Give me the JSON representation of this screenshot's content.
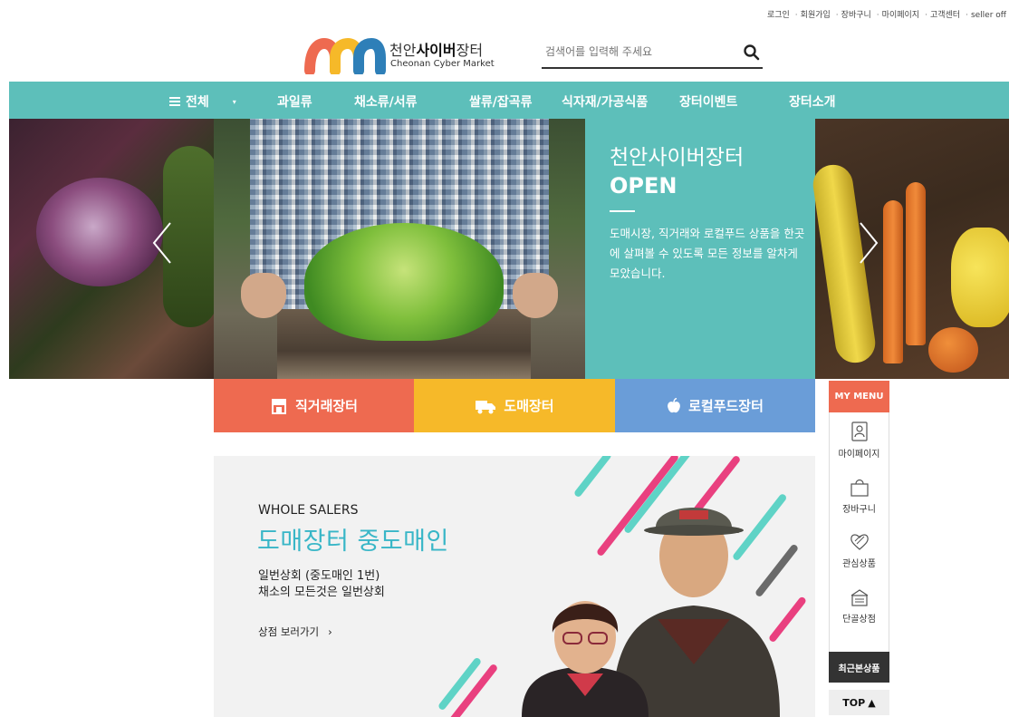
{
  "util": {
    "links": [
      "로그인",
      "회원가입",
      "장바구니",
      "마이페이지",
      "고객센터",
      "seller off"
    ]
  },
  "header": {
    "logo_kr_prefix": "천안",
    "logo_kr_bold": "사이버",
    "logo_kr_suffix": "장터",
    "logo_en": "Cheonan Cyber Market",
    "search_placeholder": "검색어를 입력해 주세요",
    "search_icon": "search-icon"
  },
  "nav": {
    "all_label": "전체",
    "items": [
      "과일류",
      "채소류/서류",
      "쌀류/잡곡류",
      "식자재/가공식품",
      "장터이벤트",
      "장터소개"
    ]
  },
  "hero": {
    "title": "천안사이버장터",
    "open": "OPEN",
    "description": "도매시장, 직거래와 로컬푸드 상품을 한곳에 살펴볼 수 있도록 모든 정보를 알차게 모았습니다."
  },
  "categories": [
    {
      "label": "직거래장터",
      "icon": "store-icon",
      "color": "#ee6a50"
    },
    {
      "label": "도매장터",
      "icon": "truck-icon",
      "color": "#f6b929"
    },
    {
      "label": "로컬푸드장터",
      "icon": "apple-icon",
      "color": "#6a9dd8"
    }
  ],
  "banner": {
    "en_label": "WHOLE SALERS",
    "title": "도매장터 중도매인",
    "sub1": "일번상회 (중도매인 1번)",
    "sub2": "채소의 모든것은 일번상회",
    "link": "상점 보러가기",
    "accent_color": "#38b6c7"
  },
  "mymenu": {
    "header": "MY MENU",
    "items": [
      {
        "label": "마이페이지",
        "icon": "person-icon"
      },
      {
        "label": "장바구니",
        "icon": "shopping-bag-icon"
      },
      {
        "label": "관심상품",
        "icon": "heart-icon"
      },
      {
        "label": "단골상점",
        "icon": "shop-icon"
      }
    ],
    "recent": "최근본상품",
    "top": "TOP"
  },
  "colors": {
    "teal": "#5dbfba",
    "coral": "#ee6a50",
    "yellow": "#f6b929",
    "blue": "#6a9dd8"
  }
}
